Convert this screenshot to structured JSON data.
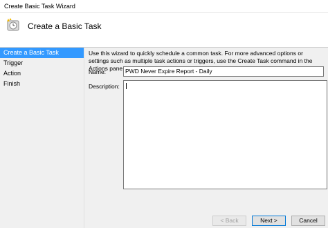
{
  "window": {
    "title": "Create Basic Task Wizard"
  },
  "header": {
    "icon": "task-scheduler-icon",
    "heading": "Create a Basic Task"
  },
  "sidebar": {
    "steps": [
      {
        "label": "Create a Basic Task",
        "active": true
      },
      {
        "label": "Trigger",
        "active": false
      },
      {
        "label": "Action",
        "active": false
      },
      {
        "label": "Finish",
        "active": false
      }
    ]
  },
  "main": {
    "description": "Use this wizard to quickly schedule a common task.  For more advanced options or settings such as multiple task actions or triggers, use the Create Task command in the Actions pane.",
    "name_label": "Name:",
    "name_value": "PWD Never Expire Report - Daily",
    "description_label": "Description:",
    "description_value": ""
  },
  "buttons": {
    "back": "< Back",
    "next": "Next >",
    "cancel": "Cancel"
  },
  "colors": {
    "selection": "#3399ff",
    "accent": "#0078d7"
  }
}
